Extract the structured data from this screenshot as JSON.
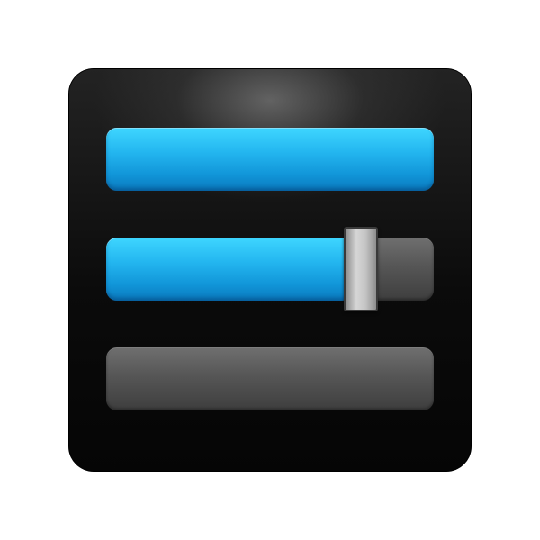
{
  "icon": {
    "name": "settings-sliders-icon",
    "background_color": "#0b0b0b",
    "accent_color": "#1ea9ea",
    "track_color": "#565656"
  },
  "sliders": [
    {
      "name": "slider-top",
      "level": 1.0
    },
    {
      "name": "slider-middle",
      "level": 0.73,
      "has_handle": true
    },
    {
      "name": "slider-bottom",
      "level": 0.0
    }
  ]
}
